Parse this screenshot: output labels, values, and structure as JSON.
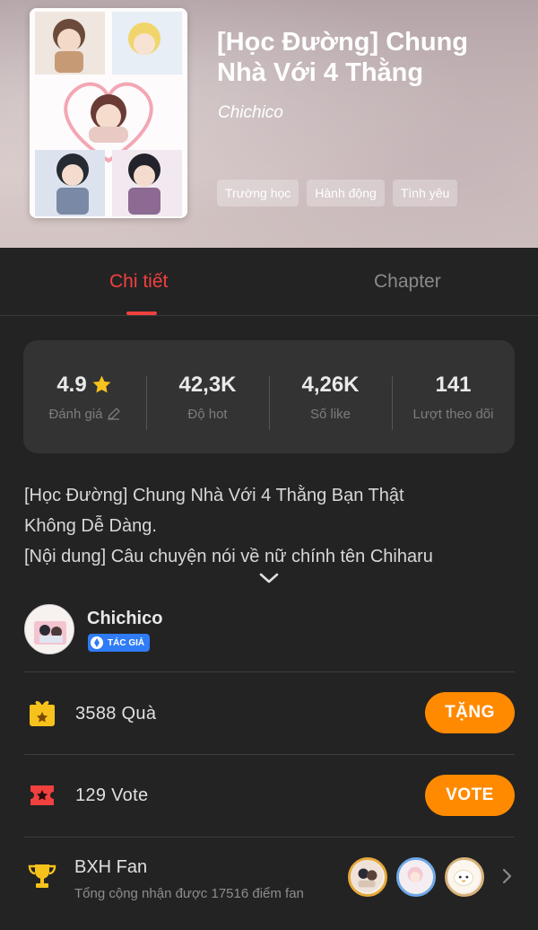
{
  "header": {
    "title": "[Học Đường] Chung\nNhà Với 4 Thằng",
    "author": "Chichico",
    "tags": [
      "Trường học",
      "Hành động",
      "Tình yêu"
    ]
  },
  "tabs": [
    {
      "label": "Chi tiết",
      "active": true
    },
    {
      "label": "Chapter",
      "active": false
    }
  ],
  "stats": [
    {
      "value": "4.9",
      "label": "Đánh giá",
      "icon": "star-icon"
    },
    {
      "value": "42,3K",
      "label": "Độ hot"
    },
    {
      "value": "4,26K",
      "label": "Số like"
    },
    {
      "value": "141",
      "label": "Lượt theo dõi"
    }
  ],
  "description": {
    "line1": "[Học Đường] Chung Nhà Với 4 Thằng Bạn Thật\nKhông Dễ Dàng.",
    "line2": "[Nội dung] Câu chuyện nói về nữ chính tên Chiharu"
  },
  "author": {
    "name": "Chichico",
    "badge": "TÁC GIẢ"
  },
  "gift": {
    "text": "3588 Quà",
    "button": "TẶNG"
  },
  "vote": {
    "text": "129 Vote",
    "button": "VOTE"
  },
  "fan": {
    "title": "BXH Fan",
    "subtitle": "Tổng cộng nhận được 17516 điểm fan"
  },
  "colors": {
    "accent": "#f0413f",
    "button": "#ff8a00",
    "badge": "#2f7cf6",
    "background": "#232323"
  }
}
